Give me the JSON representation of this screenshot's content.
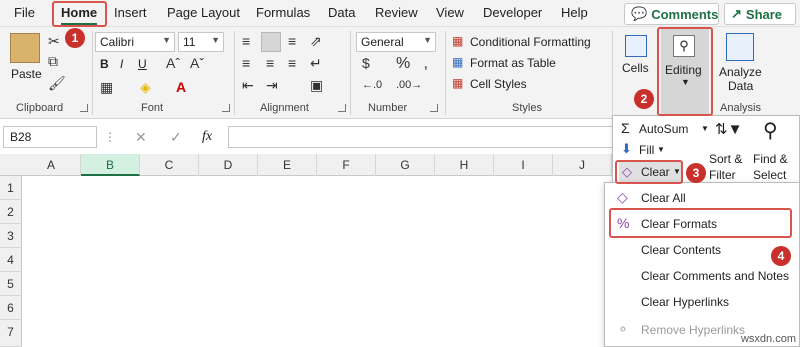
{
  "menubar": {
    "tabs": [
      "File",
      "Home",
      "Insert",
      "Page Layout",
      "Formulas",
      "Data",
      "Review",
      "View",
      "Developer",
      "Help"
    ],
    "comments_label": "Comments",
    "share_label": "Share"
  },
  "ribbon": {
    "clipboard": {
      "paste_label": "Paste",
      "group_label": "Clipboard"
    },
    "font": {
      "font_name": "Calibri",
      "font_size": "11",
      "group_label": "Font"
    },
    "alignment": {
      "group_label": "Alignment"
    },
    "number": {
      "format": "General",
      "group_label": "Number"
    },
    "styles": {
      "conditional_formatting": "Conditional Formatting",
      "format_as_table": "Format as Table",
      "cell_styles": "Cell Styles",
      "group_label": "Styles"
    },
    "cells_label": "Cells",
    "editing_label": "Editing",
    "analyze_label_1": "Analyze",
    "analyze_label_2": "Data",
    "analysis_group_label": "Analysis"
  },
  "formula_bar": {
    "name_box": "B28",
    "fx": "fx"
  },
  "columns": [
    "A",
    "B",
    "C",
    "D",
    "E",
    "F",
    "G",
    "H",
    "I",
    "J"
  ],
  "rows": [
    "1",
    "2",
    "3",
    "4",
    "5",
    "6",
    "7"
  ],
  "editing_panel": {
    "autosum": "AutoSum",
    "fill": "Fill",
    "clear": "Clear",
    "sort_filter_1": "Sort &",
    "sort_filter_2": "Filter",
    "find_select_1": "Find &",
    "find_select_2": "Select"
  },
  "clear_menu": {
    "items": [
      "Clear All",
      "Clear Formats",
      "Clear Contents",
      "Clear Comments and Notes",
      "Clear Hyperlinks",
      "Remove Hyperlinks"
    ]
  },
  "badges": [
    "1",
    "2",
    "3",
    "4"
  ],
  "watermark": "wsxdn.com",
  "colors": {
    "accent": "#1e7145",
    "highlight": "#d9534f"
  }
}
